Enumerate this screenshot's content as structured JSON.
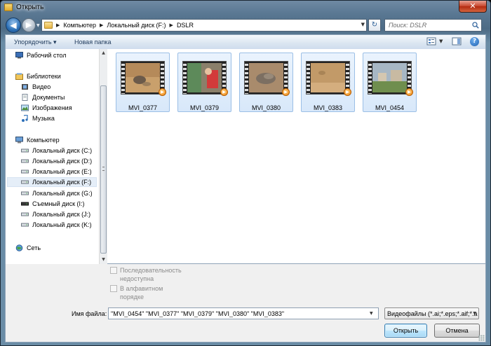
{
  "window": {
    "title": "Открыть",
    "close_glyph": "✕"
  },
  "nav": {
    "back_glyph": "◀",
    "forward_glyph": "▶",
    "drop_glyph": "▼"
  },
  "address": {
    "crumbs": [
      "Компьютер",
      "Локальный диск (F:)",
      "DSLR"
    ],
    "sep_glyph": "▶",
    "drop_glyph": "▼",
    "refresh_glyph": "↻"
  },
  "search": {
    "placeholder": "Поиск: DSLR"
  },
  "toolbar": {
    "organize_label": "Упорядочить ▾",
    "new_folder_label": "Новая папка",
    "view_drop_glyph": "▼",
    "help_glyph": "?"
  },
  "sidebar": {
    "items": [
      {
        "label": "Рабочий стол",
        "icon": "desktop-icon"
      },
      {
        "label": "Библиотеки",
        "icon": "libraries-icon"
      },
      {
        "label": "Видео",
        "icon": "video-library-icon"
      },
      {
        "label": "Документы",
        "icon": "documents-icon"
      },
      {
        "label": "Изображения",
        "icon": "pictures-icon"
      },
      {
        "label": "Музыка",
        "icon": "music-icon"
      },
      {
        "label": "Компьютер",
        "icon": "computer-icon"
      },
      {
        "label": "Локальный диск (C:)",
        "icon": "drive-icon"
      },
      {
        "label": "Локальный диск (D:)",
        "icon": "drive-icon"
      },
      {
        "label": "Локальный диск (E:)",
        "icon": "drive-icon"
      },
      {
        "label": "Локальный диск (F:)",
        "icon": "drive-icon"
      },
      {
        "label": "Локальный диск (G:)",
        "icon": "drive-icon"
      },
      {
        "label": "Съемный диск (I:)",
        "icon": "removable-drive-icon"
      },
      {
        "label": "Локальный диск (J:)",
        "icon": "drive-icon"
      },
      {
        "label": "Локальный диск (K:)",
        "icon": "drive-icon"
      },
      {
        "label": "Сеть",
        "icon": "network-icon"
      }
    ],
    "selected": "Локальный диск (F:)",
    "scroll_up_glyph": "▲",
    "scroll_down_glyph": "▼"
  },
  "files": [
    {
      "name": "MVI_0377",
      "selected": true
    },
    {
      "name": "MVI_0379",
      "selected": true
    },
    {
      "name": "MVI_0380",
      "selected": true
    },
    {
      "name": "MVI_0383",
      "selected": true
    },
    {
      "name": "MVI_0454",
      "selected": true
    }
  ],
  "play_glyph": "▶",
  "options": {
    "sequence_label": "Последовательность недоступна",
    "alphabetical_label": "В алфавитном порядке"
  },
  "footer": {
    "filename_label": "Имя файла:",
    "filename_value": "\"MVI_0454\" \"MVI_0377\" \"MVI_0379\" \"MVI_0380\" \"MVI_0383\"",
    "filetype_value": "Видеофайлы (*.ai;*.eps;*.aif;*.a",
    "drop_glyph": "▼",
    "open_label": "Открыть",
    "cancel_label": "Отмена"
  },
  "colors": {
    "selection": "#d8e8fa",
    "selection_border": "#9bbfe6",
    "play_badge": "#f08a18"
  }
}
